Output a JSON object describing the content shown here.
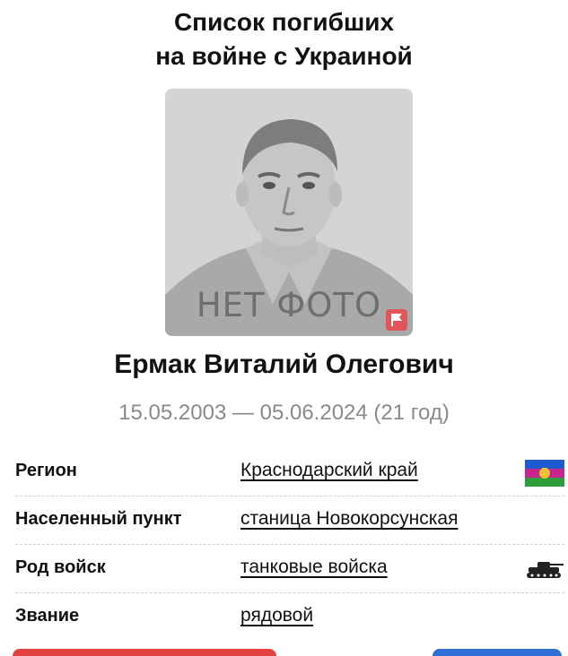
{
  "header": {
    "title_line1": "Список погибших",
    "title_line2": "на войне с Украиной"
  },
  "photo": {
    "placeholder_text": "НЕТ ФОТО",
    "report_icon": "flag-icon",
    "report_color": "#e0545a"
  },
  "person": {
    "name": "Ермак Виталий Олегович",
    "dates": "15.05.2003 — 05.06.2024 (21 год)"
  },
  "details": {
    "region_label": "Регион",
    "region_value": "Краснодарский край",
    "region_icon": "krasnodar-flag-icon",
    "settlement_label": "Населенный пункт",
    "settlement_value": "станица Новокорсунская",
    "troops_label": "Род войск",
    "troops_value": "танковые войска",
    "troops_icon": "tank-icon",
    "rank_label": "Звание",
    "rank_value": "рядовой"
  },
  "colors": {
    "accent_red": "#e34040",
    "accent_blue": "#2f6fd6",
    "muted_text": "#8a8a8a"
  }
}
